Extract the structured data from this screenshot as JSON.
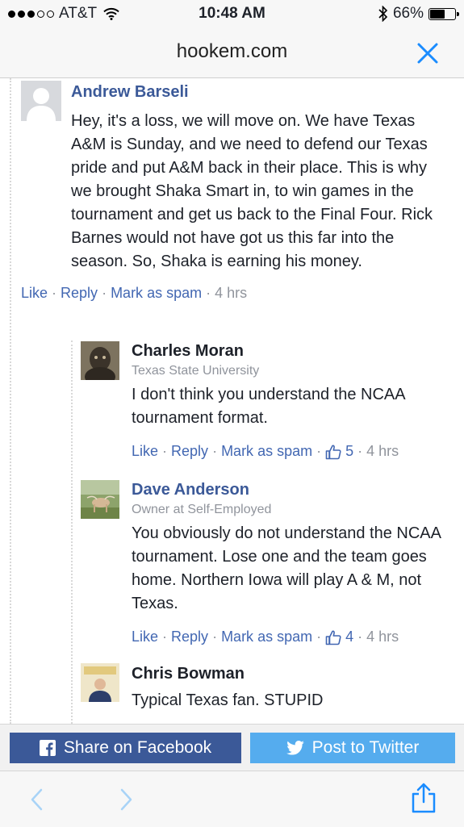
{
  "status_bar": {
    "carrier": "AT&T",
    "time": "10:48 AM",
    "battery": "66%",
    "battery_level": 0.66,
    "signal_bars": 3
  },
  "address_bar": {
    "site": "hookem.com",
    "close_icon": "close-x-icon"
  },
  "comments": [
    {
      "author": "Andrew Barseli",
      "text": "Hey, it's a loss, we will move on. We have Texas A&M is Sunday, and we need to defend our Texas pride and put A&M back in their place. This is why we brought Shaka Smart in, to win games in the tournament and get us back to the Final Four. Rick Barnes would not have got us this far into the season. So, Shaka is earning his money.",
      "actions": {
        "like": "Like",
        "reply": "Reply",
        "spam": "Mark as spam",
        "time": "4 hrs"
      }
    },
    {
      "author": "Charles Moran",
      "affiliation": "Texas State University",
      "text": "I don't think you understand the NCAA tournament format.",
      "actions": {
        "like": "Like",
        "reply": "Reply",
        "spam": "Mark as spam",
        "likes": "5",
        "time": "4 hrs"
      }
    },
    {
      "author": "Dave Anderson",
      "affiliation": "Owner at Self-Employed",
      "text": "You obviously do not understand the NCAA tournament. Lose one and the team goes home. Northern Iowa will play A & M, not Texas.",
      "actions": {
        "like": "Like",
        "reply": "Reply",
        "spam": "Mark as spam",
        "likes": "4",
        "time": "4 hrs"
      }
    },
    {
      "author": "Chris Bowman",
      "text": "Typical Texas fan. STUPID"
    }
  ],
  "share": {
    "facebook": "Share on Facebook",
    "twitter": "Post to Twitter"
  },
  "toolbar": {
    "back_icon": "chevron-left-icon",
    "forward_icon": "chevron-right-icon",
    "share_icon": "share-icon"
  },
  "colors": {
    "facebook": "#3b5998",
    "twitter": "#55acee",
    "link": "#4267b2",
    "ios_blue": "#1a8cff"
  }
}
